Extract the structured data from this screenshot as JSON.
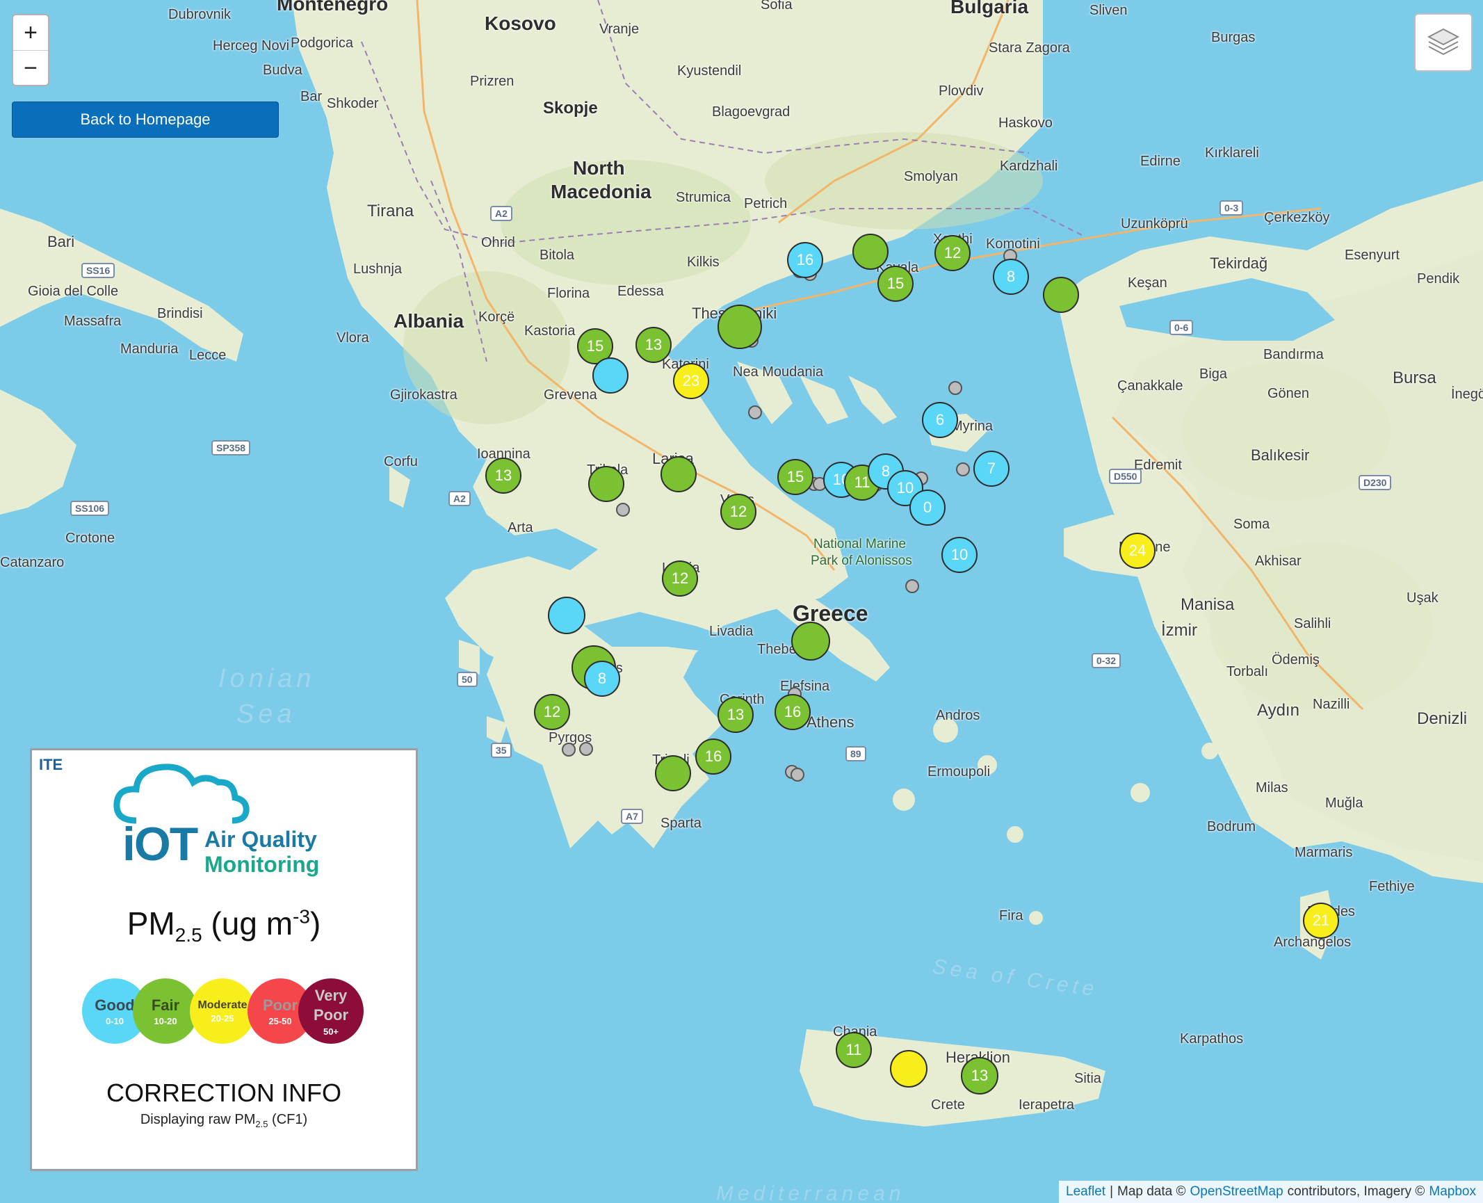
{
  "controls": {
    "zoom_in": "+",
    "zoom_out": "−",
    "back_button": "Back to Homepage",
    "layers_icon": "layers-icon"
  },
  "labels": {
    "montenegro": "Montenegro",
    "kosovo": "Kosovo",
    "sofia": "Sofia",
    "bulgaria": "Bulgaria",
    "sliven": "Sliven",
    "dubrovnik": "Dubrovnik",
    "herceg_novi": "Herceg Novi",
    "podgorica": "Podgorica",
    "vranje": "Vranje",
    "stara_zagora": "Stara Zagora",
    "burgas": "Burgas",
    "budva": "Budva",
    "kyustendil": "Kyustendil",
    "prizren": "Prizren",
    "plovdiv": "Plovdiv",
    "bar": "Bar",
    "shkoder": "Shkoder",
    "skopje": "Skopje",
    "blagoevgrad": "Blagoevgrad",
    "haskovo": "Haskovo",
    "north_macedonia_1": "North",
    "north_macedonia_2": "Macedonia",
    "smolyan": "Smolyan",
    "kardzhali": "Kardzhali",
    "edirne": "Edirne",
    "kirklareli": "Kırklareli",
    "tirana": "Tirana",
    "strumica": "Strumica",
    "petrich": "Petrich",
    "bari": "Bari",
    "ohrid": "Ohrid",
    "bitola": "Bitola",
    "kilkis": "Kilkis",
    "xanthi": "Xanthi",
    "komotini": "Komotini",
    "uzunkopru": "Uzunköprü",
    "cerkezkoy": "Çerkezköy",
    "lushnja": "Lushnja",
    "kavala": "Kavala",
    "tekirdag": "Tekirdağ",
    "esenyurt": "Esenyurt",
    "gioia": "Gioia del Colle",
    "brindisi": "Brindisi",
    "albania": "Albania",
    "korce": "Korçë",
    "florina": "Florina",
    "edessa": "Edessa",
    "thessaloniki": "Thessaloniki",
    "kesan": "Keşan",
    "pendik": "Pendik",
    "massafra": "Massafra",
    "vlora": "Vlora",
    "kastoria": "Kastoria",
    "manduria": "Manduria",
    "lecce": "Lecce",
    "katerini": "Katerini",
    "nea_moudania": "Nea Moudania",
    "bandirma": "Bandırma",
    "bursa": "Bursa",
    "gjirokastra": "Gjirokastra",
    "grevena": "Grevena",
    "canakkale": "Çanakkale",
    "biga": "Biga",
    "gonen": "Gönen",
    "inegol": "İnegöl",
    "myrina": "Myrina",
    "corfu": "Corfu",
    "ioannina": "Ioannina",
    "larisa": "Larisa",
    "trikala": "Trikala",
    "edremit": "Edremit",
    "balikesir": "Balıkesir",
    "volos": "Volos",
    "arta": "Arta",
    "park_1": "National Marine",
    "park_2": "Park of Alonissos",
    "soma": "Soma",
    "crotone": "Crotone",
    "catanzaro": "Catanzaro",
    "lamia": "Lamia",
    "mytilene": "Mytilene",
    "akhisar": "Akhisar",
    "greece": "Greece",
    "manisa": "Manisa",
    "usak": "Uşak",
    "livadia": "Livadia",
    "izmir": "İzmir",
    "salihli": "Salihli",
    "thebes": "Thebes",
    "odemis": "Ödemiş",
    "ionian_1": "Ionian",
    "ionian_2": "Sea",
    "patras": "Patras",
    "elefsina": "Elefsina",
    "torbali": "Torbalı",
    "corinth": "Corinth",
    "aydin": "Aydın",
    "nazilli": "Nazilli",
    "denizli": "Denizli",
    "athens": "Athens",
    "andros": "Andros",
    "pyrgos": "Pyrgos",
    "tripoli": "Tripoli",
    "ermoupoli": "Ermoupoli",
    "milas": "Milas",
    "mugla": "Muğla",
    "sparta": "Sparta",
    "bodrum": "Bodrum",
    "marmaris": "Marmaris",
    "fethiye": "Fethiye",
    "fira": "Fira",
    "rhodes": "Rhodes",
    "archangelos": "Archangelos",
    "sea_of_crete": "Sea of Crete",
    "karpathos": "Karpathos",
    "chania": "Chania",
    "heraklion": "Heraklion",
    "sitia": "Sitia",
    "crete": "Crete",
    "ierapetra": "Ierapetra",
    "mediterranean": "Mediterranean"
  },
  "road_shields": [
    "SS16",
    "A2",
    "SP358",
    "SS106",
    "A2",
    "50",
    "35",
    "A7",
    "89",
    "0-3",
    "0-6",
    "D550",
    "D230",
    "0-32"
  ],
  "markers": [
    {
      "value": "16",
      "category": "good"
    },
    {
      "value": "",
      "category": "fair"
    },
    {
      "value": "15",
      "category": "fair"
    },
    {
      "value": "12",
      "category": "fair"
    },
    {
      "value": "8",
      "category": "good"
    },
    {
      "value": "",
      "category": "fair"
    },
    {
      "value": "",
      "category": "fair"
    },
    {
      "value": "15",
      "category": "fair"
    },
    {
      "value": "13",
      "category": "fair"
    },
    {
      "value": "",
      "category": "good"
    },
    {
      "value": "23",
      "category": "moderate"
    },
    {
      "value": "6",
      "category": "good"
    },
    {
      "value": "7",
      "category": "good"
    },
    {
      "value": "15",
      "category": "fair"
    },
    {
      "value": "10",
      "category": "good"
    },
    {
      "value": "11",
      "category": "fair"
    },
    {
      "value": "8",
      "category": "good"
    },
    {
      "value": "10",
      "category": "good"
    },
    {
      "value": "0",
      "category": "good"
    },
    {
      "value": "13",
      "category": "fair"
    },
    {
      "value": "",
      "category": "fair"
    },
    {
      "value": "",
      "category": "fair"
    },
    {
      "value": "12",
      "category": "fair"
    },
    {
      "value": "10",
      "category": "good"
    },
    {
      "value": "24",
      "category": "moderate"
    },
    {
      "value": "12",
      "category": "fair"
    },
    {
      "value": "",
      "category": "good"
    },
    {
      "value": "",
      "category": "fair"
    },
    {
      "value": "",
      "category": "fair"
    },
    {
      "value": "8",
      "category": "good"
    },
    {
      "value": "12",
      "category": "fair"
    },
    {
      "value": "13",
      "category": "fair"
    },
    {
      "value": "16",
      "category": "fair"
    },
    {
      "value": "16",
      "category": "fair"
    },
    {
      "value": "",
      "category": "fair"
    },
    {
      "value": "21",
      "category": "moderate"
    },
    {
      "value": "11",
      "category": "fair"
    },
    {
      "value": "",
      "category": "moderate"
    },
    {
      "value": "13",
      "category": "fair"
    }
  ],
  "legend": {
    "logo_org": "ITE",
    "logo_iot": "iOT",
    "logo_line1": "Air Quality",
    "logo_line2": "Monitoring",
    "pm_main": "PM",
    "pm_sub": "2.5",
    "pm_unit_pre": " (ug m",
    "pm_unit_sup": "-3",
    "pm_unit_post": ")",
    "categories": [
      {
        "label": "Good",
        "range": "0-10",
        "color": "#5ad6f7"
      },
      {
        "label": "Fair",
        "range": "10-20",
        "color": "#7ac231"
      },
      {
        "label": "Moderate",
        "range": "20-25",
        "color": "#f7ee1c"
      },
      {
        "label": "Poor",
        "range": "25-50",
        "color": "#f5474b"
      },
      {
        "label": "Very Poor",
        "range": "50+",
        "color": "#8c0d3a"
      }
    ],
    "correction_title": "CORRECTION INFO",
    "correction_text_pre": "Displaying raw PM",
    "correction_text_sub": "2.5",
    "correction_text_post": " (CF1)"
  },
  "attribution": {
    "leaflet": "Leaflet",
    "sep": "|",
    "map_data": "Map data ©",
    "osm": "OpenStreetMap",
    "contributors": "contributors, Imagery ©",
    "mapbox": "Mapbox"
  },
  "colors": {
    "sea": "#7ccbe9",
    "land": "#e9efd8",
    "good": "#5ad6f7",
    "fair": "#7ac231",
    "moderate": "#f7ee1c",
    "poor": "#f5474b",
    "very_poor": "#8c0d3a"
  }
}
